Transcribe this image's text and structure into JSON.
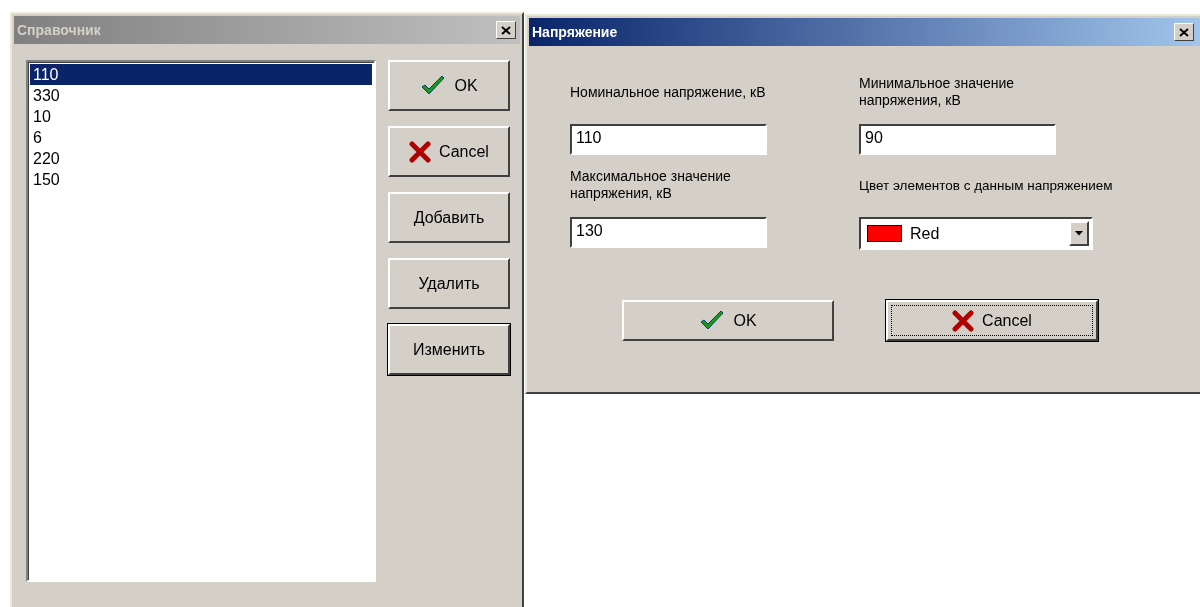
{
  "reference_window": {
    "title": "Справочник",
    "active": false,
    "items": [
      {
        "label": "110",
        "selected": true
      },
      {
        "label": "330",
        "selected": false
      },
      {
        "label": "10",
        "selected": false
      },
      {
        "label": "6",
        "selected": false
      },
      {
        "label": "220",
        "selected": false
      },
      {
        "label": "150",
        "selected": false
      }
    ],
    "buttons": [
      {
        "label": "OK",
        "kind": "confirm",
        "default": false
      },
      {
        "label": "Cancel",
        "kind": "dismiss",
        "default": false
      },
      {
        "label": "Добавить",
        "kind": "plain",
        "default": false
      },
      {
        "label": "Удалить",
        "kind": "plain",
        "default": false
      },
      {
        "label": "Изменить",
        "kind": "plain",
        "default": true
      }
    ]
  },
  "voltage_window": {
    "title": "Напряжение",
    "active": true,
    "fields": [
      {
        "kind": "text",
        "label": "Номинальное напряжение, кВ",
        "value": "110"
      },
      {
        "kind": "text",
        "label": "Минимальное значение напряжения, кВ",
        "value": "90"
      },
      {
        "kind": "text",
        "label": "Максимальное значение напряжения, кВ",
        "value": "130"
      },
      {
        "kind": "color",
        "label": "Цвет элементов с данным напряжением",
        "value": "Red",
        "color": "#ff0000"
      }
    ],
    "buttons": [
      {
        "label": "OK",
        "kind": "confirm",
        "focused": false
      },
      {
        "label": "Cancel",
        "kind": "dismiss",
        "focused": true
      }
    ]
  }
}
